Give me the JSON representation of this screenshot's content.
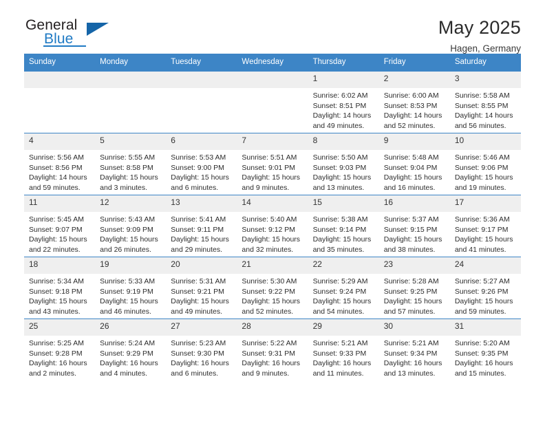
{
  "logo": {
    "word_one": "General",
    "word_two": "Blue",
    "triangle_icon": "triangle-icon",
    "accent_color": "#1f7ac4"
  },
  "header": {
    "title": "May 2025",
    "subtitle": "Hagen, Germany"
  },
  "calendar": {
    "header_color": "#3d85c6",
    "daynum_bg": "#efefef",
    "weekday_headers": [
      "Sunday",
      "Monday",
      "Tuesday",
      "Wednesday",
      "Thursday",
      "Friday",
      "Saturday"
    ],
    "weeks": [
      [
        {
          "day": "",
          "empty": true,
          "sunrise": "",
          "sunset": "",
          "daylight_1": "",
          "daylight_2": ""
        },
        {
          "day": "",
          "empty": true,
          "sunrise": "",
          "sunset": "",
          "daylight_1": "",
          "daylight_2": ""
        },
        {
          "day": "",
          "empty": true,
          "sunrise": "",
          "sunset": "",
          "daylight_1": "",
          "daylight_2": ""
        },
        {
          "day": "",
          "empty": true,
          "sunrise": "",
          "sunset": "",
          "daylight_1": "",
          "daylight_2": ""
        },
        {
          "day": "1",
          "empty": false,
          "sunrise": "Sunrise: 6:02 AM",
          "sunset": "Sunset: 8:51 PM",
          "daylight_1": "Daylight: 14 hours",
          "daylight_2": "and 49 minutes."
        },
        {
          "day": "2",
          "empty": false,
          "sunrise": "Sunrise: 6:00 AM",
          "sunset": "Sunset: 8:53 PM",
          "daylight_1": "Daylight: 14 hours",
          "daylight_2": "and 52 minutes."
        },
        {
          "day": "3",
          "empty": false,
          "sunrise": "Sunrise: 5:58 AM",
          "sunset": "Sunset: 8:55 PM",
          "daylight_1": "Daylight: 14 hours",
          "daylight_2": "and 56 minutes."
        }
      ],
      [
        {
          "day": "4",
          "empty": false,
          "sunrise": "Sunrise: 5:56 AM",
          "sunset": "Sunset: 8:56 PM",
          "daylight_1": "Daylight: 14 hours",
          "daylight_2": "and 59 minutes."
        },
        {
          "day": "5",
          "empty": false,
          "sunrise": "Sunrise: 5:55 AM",
          "sunset": "Sunset: 8:58 PM",
          "daylight_1": "Daylight: 15 hours",
          "daylight_2": "and 3 minutes."
        },
        {
          "day": "6",
          "empty": false,
          "sunrise": "Sunrise: 5:53 AM",
          "sunset": "Sunset: 9:00 PM",
          "daylight_1": "Daylight: 15 hours",
          "daylight_2": "and 6 minutes."
        },
        {
          "day": "7",
          "empty": false,
          "sunrise": "Sunrise: 5:51 AM",
          "sunset": "Sunset: 9:01 PM",
          "daylight_1": "Daylight: 15 hours",
          "daylight_2": "and 9 minutes."
        },
        {
          "day": "8",
          "empty": false,
          "sunrise": "Sunrise: 5:50 AM",
          "sunset": "Sunset: 9:03 PM",
          "daylight_1": "Daylight: 15 hours",
          "daylight_2": "and 13 minutes."
        },
        {
          "day": "9",
          "empty": false,
          "sunrise": "Sunrise: 5:48 AM",
          "sunset": "Sunset: 9:04 PM",
          "daylight_1": "Daylight: 15 hours",
          "daylight_2": "and 16 minutes."
        },
        {
          "day": "10",
          "empty": false,
          "sunrise": "Sunrise: 5:46 AM",
          "sunset": "Sunset: 9:06 PM",
          "daylight_1": "Daylight: 15 hours",
          "daylight_2": "and 19 minutes."
        }
      ],
      [
        {
          "day": "11",
          "empty": false,
          "sunrise": "Sunrise: 5:45 AM",
          "sunset": "Sunset: 9:07 PM",
          "daylight_1": "Daylight: 15 hours",
          "daylight_2": "and 22 minutes."
        },
        {
          "day": "12",
          "empty": false,
          "sunrise": "Sunrise: 5:43 AM",
          "sunset": "Sunset: 9:09 PM",
          "daylight_1": "Daylight: 15 hours",
          "daylight_2": "and 26 minutes."
        },
        {
          "day": "13",
          "empty": false,
          "sunrise": "Sunrise: 5:41 AM",
          "sunset": "Sunset: 9:11 PM",
          "daylight_1": "Daylight: 15 hours",
          "daylight_2": "and 29 minutes."
        },
        {
          "day": "14",
          "empty": false,
          "sunrise": "Sunrise: 5:40 AM",
          "sunset": "Sunset: 9:12 PM",
          "daylight_1": "Daylight: 15 hours",
          "daylight_2": "and 32 minutes."
        },
        {
          "day": "15",
          "empty": false,
          "sunrise": "Sunrise: 5:38 AM",
          "sunset": "Sunset: 9:14 PM",
          "daylight_1": "Daylight: 15 hours",
          "daylight_2": "and 35 minutes."
        },
        {
          "day": "16",
          "empty": false,
          "sunrise": "Sunrise: 5:37 AM",
          "sunset": "Sunset: 9:15 PM",
          "daylight_1": "Daylight: 15 hours",
          "daylight_2": "and 38 minutes."
        },
        {
          "day": "17",
          "empty": false,
          "sunrise": "Sunrise: 5:36 AM",
          "sunset": "Sunset: 9:17 PM",
          "daylight_1": "Daylight: 15 hours",
          "daylight_2": "and 41 minutes."
        }
      ],
      [
        {
          "day": "18",
          "empty": false,
          "sunrise": "Sunrise: 5:34 AM",
          "sunset": "Sunset: 9:18 PM",
          "daylight_1": "Daylight: 15 hours",
          "daylight_2": "and 43 minutes."
        },
        {
          "day": "19",
          "empty": false,
          "sunrise": "Sunrise: 5:33 AM",
          "sunset": "Sunset: 9:19 PM",
          "daylight_1": "Daylight: 15 hours",
          "daylight_2": "and 46 minutes."
        },
        {
          "day": "20",
          "empty": false,
          "sunrise": "Sunrise: 5:31 AM",
          "sunset": "Sunset: 9:21 PM",
          "daylight_1": "Daylight: 15 hours",
          "daylight_2": "and 49 minutes."
        },
        {
          "day": "21",
          "empty": false,
          "sunrise": "Sunrise: 5:30 AM",
          "sunset": "Sunset: 9:22 PM",
          "daylight_1": "Daylight: 15 hours",
          "daylight_2": "and 52 minutes."
        },
        {
          "day": "22",
          "empty": false,
          "sunrise": "Sunrise: 5:29 AM",
          "sunset": "Sunset: 9:24 PM",
          "daylight_1": "Daylight: 15 hours",
          "daylight_2": "and 54 minutes."
        },
        {
          "day": "23",
          "empty": false,
          "sunrise": "Sunrise: 5:28 AM",
          "sunset": "Sunset: 9:25 PM",
          "daylight_1": "Daylight: 15 hours",
          "daylight_2": "and 57 minutes."
        },
        {
          "day": "24",
          "empty": false,
          "sunrise": "Sunrise: 5:27 AM",
          "sunset": "Sunset: 9:26 PM",
          "daylight_1": "Daylight: 15 hours",
          "daylight_2": "and 59 minutes."
        }
      ],
      [
        {
          "day": "25",
          "empty": false,
          "sunrise": "Sunrise: 5:25 AM",
          "sunset": "Sunset: 9:28 PM",
          "daylight_1": "Daylight: 16 hours",
          "daylight_2": "and 2 minutes."
        },
        {
          "day": "26",
          "empty": false,
          "sunrise": "Sunrise: 5:24 AM",
          "sunset": "Sunset: 9:29 PM",
          "daylight_1": "Daylight: 16 hours",
          "daylight_2": "and 4 minutes."
        },
        {
          "day": "27",
          "empty": false,
          "sunrise": "Sunrise: 5:23 AM",
          "sunset": "Sunset: 9:30 PM",
          "daylight_1": "Daylight: 16 hours",
          "daylight_2": "and 6 minutes."
        },
        {
          "day": "28",
          "empty": false,
          "sunrise": "Sunrise: 5:22 AM",
          "sunset": "Sunset: 9:31 PM",
          "daylight_1": "Daylight: 16 hours",
          "daylight_2": "and 9 minutes."
        },
        {
          "day": "29",
          "empty": false,
          "sunrise": "Sunrise: 5:21 AM",
          "sunset": "Sunset: 9:33 PM",
          "daylight_1": "Daylight: 16 hours",
          "daylight_2": "and 11 minutes."
        },
        {
          "day": "30",
          "empty": false,
          "sunrise": "Sunrise: 5:21 AM",
          "sunset": "Sunset: 9:34 PM",
          "daylight_1": "Daylight: 16 hours",
          "daylight_2": "and 13 minutes."
        },
        {
          "day": "31",
          "empty": false,
          "sunrise": "Sunrise: 5:20 AM",
          "sunset": "Sunset: 9:35 PM",
          "daylight_1": "Daylight: 16 hours",
          "daylight_2": "and 15 minutes."
        }
      ]
    ]
  }
}
